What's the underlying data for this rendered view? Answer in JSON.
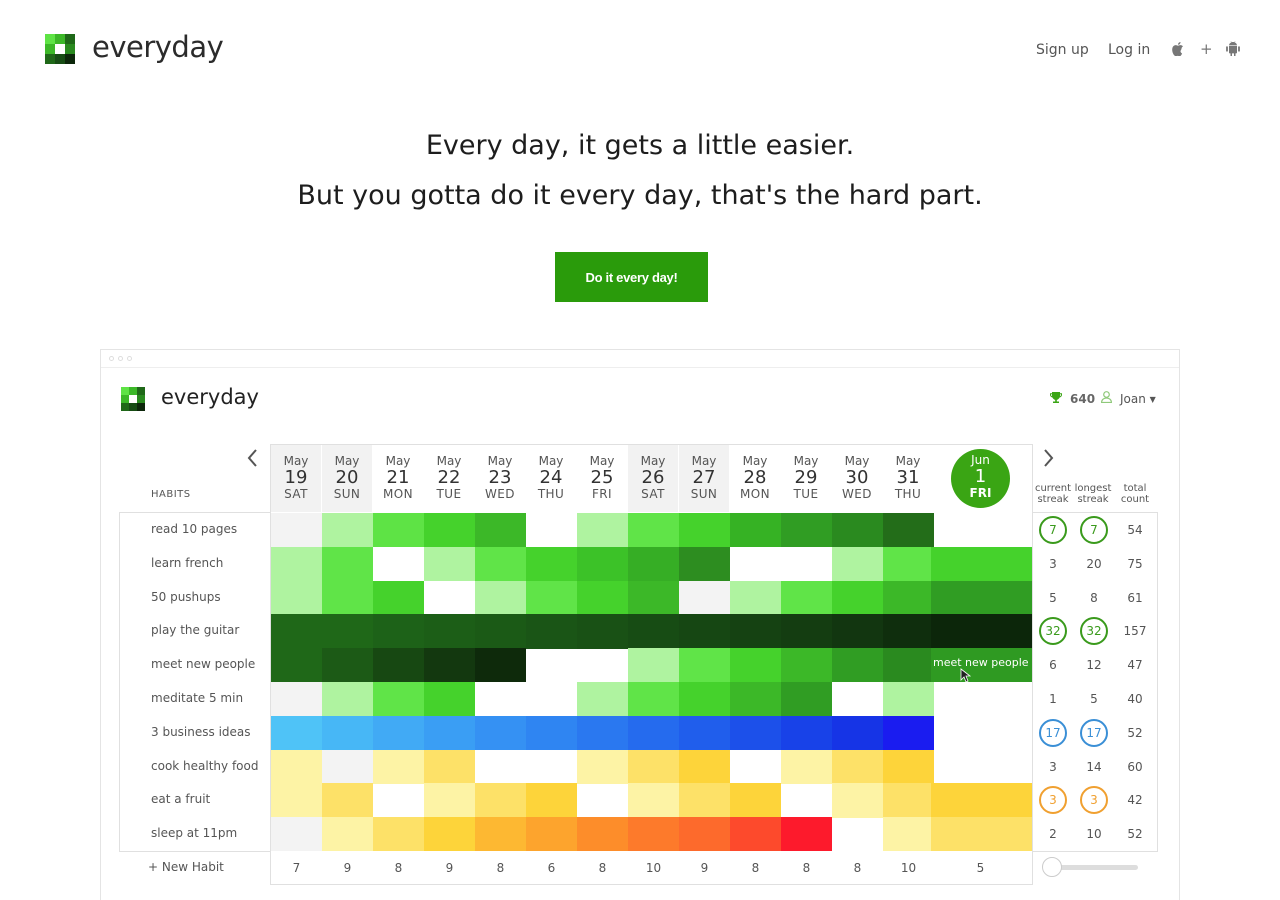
{
  "site": {
    "name": "everyday",
    "nav": {
      "signup": "Sign up",
      "login": "Log in",
      "plus": "+"
    },
    "hero_line1": "Every day, it gets a little easier.",
    "hero_line2": "But you gotta do it every day, that's the hard part.",
    "cta": "Do it every day!"
  },
  "app": {
    "name": "everyday",
    "points": "640",
    "user": "Joan",
    "habits_header": "HABITS",
    "stats_headers": {
      "current": "current\nstreak",
      "longest": "longest\nstreak",
      "total": "total\ncount"
    },
    "days": [
      {
        "m": "May",
        "d": "19",
        "w": "SAT"
      },
      {
        "m": "May",
        "d": "20",
        "w": "SUN"
      },
      {
        "m": "May",
        "d": "21",
        "w": "MON"
      },
      {
        "m": "May",
        "d": "22",
        "w": "TUE"
      },
      {
        "m": "May",
        "d": "23",
        "w": "WED"
      },
      {
        "m": "May",
        "d": "24",
        "w": "THU"
      },
      {
        "m": "May",
        "d": "25",
        "w": "FRI"
      },
      {
        "m": "May",
        "d": "26",
        "w": "SAT"
      },
      {
        "m": "May",
        "d": "27",
        "w": "SUN"
      },
      {
        "m": "May",
        "d": "28",
        "w": "MON"
      },
      {
        "m": "May",
        "d": "29",
        "w": "TUE"
      },
      {
        "m": "May",
        "d": "30",
        "w": "WED"
      },
      {
        "m": "May",
        "d": "31",
        "w": "THU"
      }
    ],
    "today": {
      "m": "Jun",
      "d": "1",
      "w": "FRI"
    },
    "habits": [
      {
        "name": "read 10 pages",
        "current": "7",
        "longest": "7",
        "total": "54",
        "ring": "green"
      },
      {
        "name": "learn french",
        "current": "3",
        "longest": "20",
        "total": "75",
        "ring": ""
      },
      {
        "name": "50 pushups",
        "current": "5",
        "longest": "8",
        "total": "61",
        "ring": ""
      },
      {
        "name": "play the guitar",
        "current": "32",
        "longest": "32",
        "total": "157",
        "ring": "green"
      },
      {
        "name": "meet new people",
        "current": "6",
        "longest": "12",
        "total": "47",
        "ring": ""
      },
      {
        "name": "meditate 5 min",
        "current": "1",
        "longest": "5",
        "total": "40",
        "ring": ""
      },
      {
        "name": "3 business ideas",
        "current": "17",
        "longest": "17",
        "total": "52",
        "ring": "blue"
      },
      {
        "name": "cook healthy food",
        "current": "3",
        "longest": "14",
        "total": "60",
        "ring": ""
      },
      {
        "name": "eat a fruit",
        "current": "3",
        "longest": "3",
        "total": "42",
        "ring": "orange"
      },
      {
        "name": "sleep at 11pm",
        "current": "2",
        "longest": "10",
        "total": "52",
        "ring": ""
      }
    ],
    "grid_colors": [
      [
        "#f3f3f3",
        "#aff3a0",
        "#5ee345",
        "#45d22c",
        "#3cb828",
        "",
        "#aff3a0",
        "#60e448",
        "#45d22c",
        "#36b224",
        "#309d23",
        "#2a8a1f",
        "#236d19",
        ""
      ],
      [
        "#aff3a0",
        "#60e448",
        "",
        "#aff3a0",
        "#60e448",
        "#45d22c",
        "#3cc228",
        "#36ae25",
        "#2d8d20",
        "",
        "",
        "#aff3a0",
        "#60e448",
        "#45d22c"
      ],
      [
        "#aff3a0",
        "#60e448",
        "#45d22c",
        "",
        "#aff3a0",
        "#60e448",
        "#45d22c",
        "#3cb828",
        "#f3f3f3",
        "#aff3a0",
        "#60e448",
        "#45d22c",
        "#3cb828",
        "#309d23"
      ],
      [
        "#1f6818",
        "#1f6818",
        "#1d6218",
        "#1c5e17",
        "#1b5a16",
        "#1a5516",
        "#195115",
        "#174c14",
        "#164713",
        "#154212",
        "#143d11",
        "#123610",
        "#0f2e0d",
        "#0c260a"
      ],
      [
        "#1f6818",
        "#1c5a16",
        "#174812",
        "#13380f",
        "#0e2a0b",
        "",
        "",
        "#aff3a0",
        "#60e448",
        "#45d22c",
        "#3cb828",
        "#309d23",
        "#2a8a1f",
        "#2f9a22"
      ],
      [
        "#f3f3f3",
        "#aff3a0",
        "#60e448",
        "#45d22c",
        "",
        "",
        "#aff3a0",
        "#60e448",
        "#45d22c",
        "#3cb828",
        "#309d23",
        "",
        "#aff3a0",
        ""
      ],
      [
        "#4fc3f7",
        "#47b7f6",
        "#41aaf5",
        "#3a9ef4",
        "#3591f3",
        "#2f85f2",
        "#2a78f0",
        "#256bee",
        "#205eec",
        "#1c50ea",
        "#1842e8",
        "#1634e6",
        "#1a1cf0",
        ""
      ],
      [
        "#fdf3a5",
        "#f3f3f3",
        "#fdf3a5",
        "#fde168",
        "",
        "",
        "#fdf3a5",
        "#fde168",
        "#fdd43a",
        "",
        "#fdf3a5",
        "#fde168",
        "#fdd43a",
        ""
      ],
      [
        "#fdf3a5",
        "#fde168",
        "",
        "#fdf3a5",
        "#fde168",
        "#fdd43a",
        "",
        "#fdf3a5",
        "#fde168",
        "#fdd43a",
        "",
        "#fdf3a5",
        "#fde168",
        "#fdd43a"
      ],
      [
        "#f3f3f3",
        "#fdf3a5",
        "#fde168",
        "#fdd43a",
        "#fdb832",
        "#fda42d",
        "#fd8d2a",
        "#fd7a2b",
        "#fd6a2c",
        "#fd4a2c",
        "#fd1a2c",
        "",
        "#fdf3a5",
        "#fde168"
      ]
    ],
    "tooltip": "meet new people",
    "new_habit": "+ New Habit",
    "totals": [
      "7",
      "9",
      "8",
      "9",
      "8",
      "6",
      "8",
      "10",
      "9",
      "8",
      "8",
      "8",
      "10",
      "5"
    ]
  }
}
